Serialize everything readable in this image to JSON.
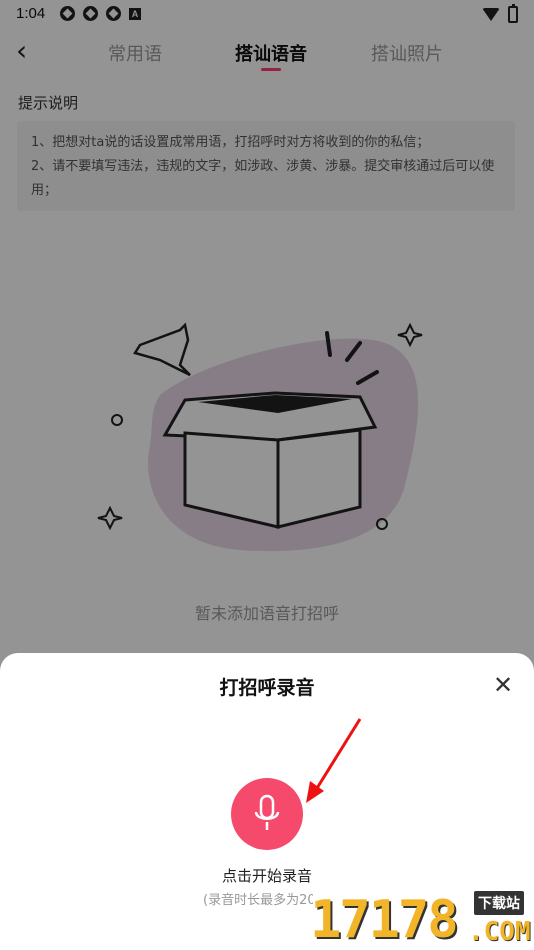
{
  "status": {
    "time": "1:04",
    "badge": "A"
  },
  "nav": {
    "tabs": [
      {
        "label": "常用语"
      },
      {
        "label": "搭讪语音"
      },
      {
        "label": "搭讪照片"
      }
    ]
  },
  "tips": {
    "title": "提示说明",
    "line1": "1、把想对ta说的话设置成常用语，打招呼时对方将收到的你的私信；",
    "line2": "2、请不要填写违法，违规的文字，如涉政、涉黄、涉暴。提交审核通过后可以使用；"
  },
  "empty": {
    "text": "暂未添加语音打招呼"
  },
  "sheet": {
    "title": "打招呼录音",
    "record_label": "点击开始录音",
    "record_hint": "(录音时长最多为20"
  },
  "watermark": {
    "number": "17178",
    "tag": "下载站",
    "suffix": ".COM"
  },
  "colors": {
    "accent": "#f54a6b",
    "tab_underline": "#ff3f6c"
  }
}
